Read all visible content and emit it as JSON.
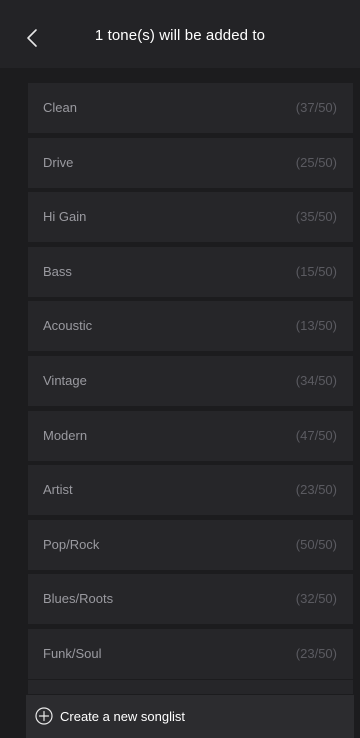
{
  "header": {
    "back_icon": "chevron-left-icon",
    "title": "1 tone(s) will be added to"
  },
  "songlists": [
    {
      "label": "Clean",
      "count": "(37/50)"
    },
    {
      "label": "Drive",
      "count": "(25/50)"
    },
    {
      "label": "Hi Gain",
      "count": "(35/50)"
    },
    {
      "label": "Bass",
      "count": "(15/50)"
    },
    {
      "label": "Acoustic",
      "count": "(13/50)"
    },
    {
      "label": "Vintage",
      "count": "(34/50)"
    },
    {
      "label": "Modern",
      "count": "(47/50)"
    },
    {
      "label": "Artist",
      "count": "(23/50)"
    },
    {
      "label": "Pop/Rock",
      "count": "(50/50)"
    },
    {
      "label": "Blues/Roots",
      "count": "(32/50)"
    },
    {
      "label": "Funk/Soul",
      "count": "(23/50)"
    }
  ],
  "create": {
    "icon": "plus-circle-icon",
    "label": "Create a new songlist"
  },
  "colors": {
    "background": "#1c1c1e",
    "header": "#232326",
    "item": "#262629",
    "item_label": "#9a9aa0",
    "item_count": "#5b5b61",
    "create_bar": "#2c2c2f"
  }
}
